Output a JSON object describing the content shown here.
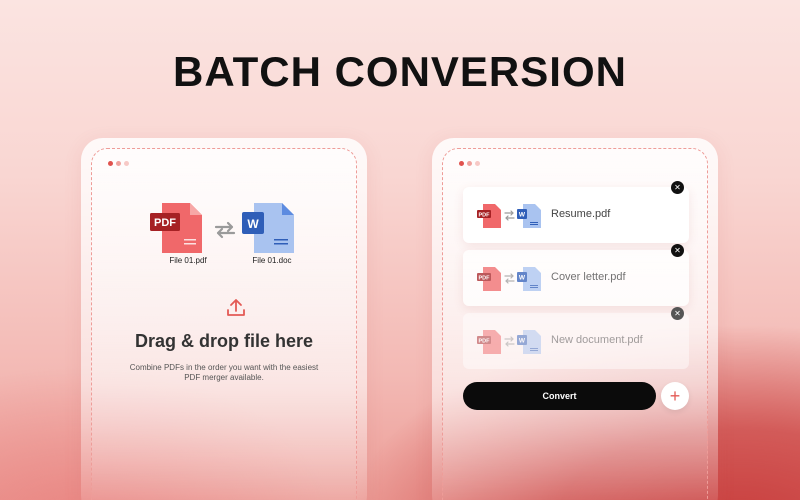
{
  "headline": "BATCH CONVERSION",
  "left_card": {
    "window_dots": [
      "#e0524e",
      "#f0a29e",
      "#f7c9c6"
    ],
    "source_file": {
      "badge": "PDF",
      "caption": "File 01.pdf",
      "color": "#e0524e"
    },
    "target_file": {
      "badge": "W",
      "caption": "File 01.doc",
      "color": "#2f64c5"
    },
    "icons": {
      "swap": "swap-arrows-icon",
      "upload": "upload-icon"
    },
    "title": "Drag & drop file here",
    "subtitle": "Combine PDFs in the order you want with the easiest PDF merger available."
  },
  "right_card": {
    "window_dots": [
      "#e0524e",
      "#f0a29e",
      "#f7c9c6"
    ],
    "files": [
      {
        "name": "Resume.pdf",
        "pdf_badge": "PDF",
        "word_badge": "W"
      },
      {
        "name": "Cover letter.pdf",
        "pdf_badge": "PDF",
        "word_badge": "W"
      },
      {
        "name": "New document.pdf",
        "pdf_badge": "PDF",
        "word_badge": "W"
      }
    ],
    "close_glyph": "✕",
    "convert_label": "Convert",
    "add_glyph": "+"
  }
}
